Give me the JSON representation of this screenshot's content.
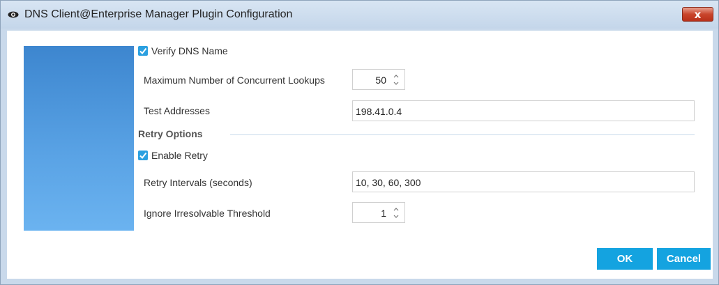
{
  "window": {
    "title": "DNS Client@Enterprise Manager Plugin Configuration",
    "close_label": "x"
  },
  "verify_dns": {
    "label": "Verify DNS Name",
    "checked": true
  },
  "max_lookups": {
    "label": "Maximum Number of Concurrent Lookups",
    "value": "50"
  },
  "test_addresses": {
    "label": "Test Addresses",
    "value": "198.41.0.4"
  },
  "retry_options": {
    "heading": "Retry Options"
  },
  "enable_retry": {
    "label": "Enable Retry",
    "checked": true
  },
  "retry_intervals": {
    "label": "Retry Intervals (seconds)",
    "value": "10, 30, 60, 300"
  },
  "irresolvable": {
    "label": "Ignore Irresolvable Threshold",
    "value": "1"
  },
  "buttons": {
    "ok": "OK",
    "cancel": "Cancel"
  },
  "colors": {
    "accent": "#14a3e0",
    "checkbox": "#2ba0e0",
    "side_panel": "#5aa3e5"
  }
}
